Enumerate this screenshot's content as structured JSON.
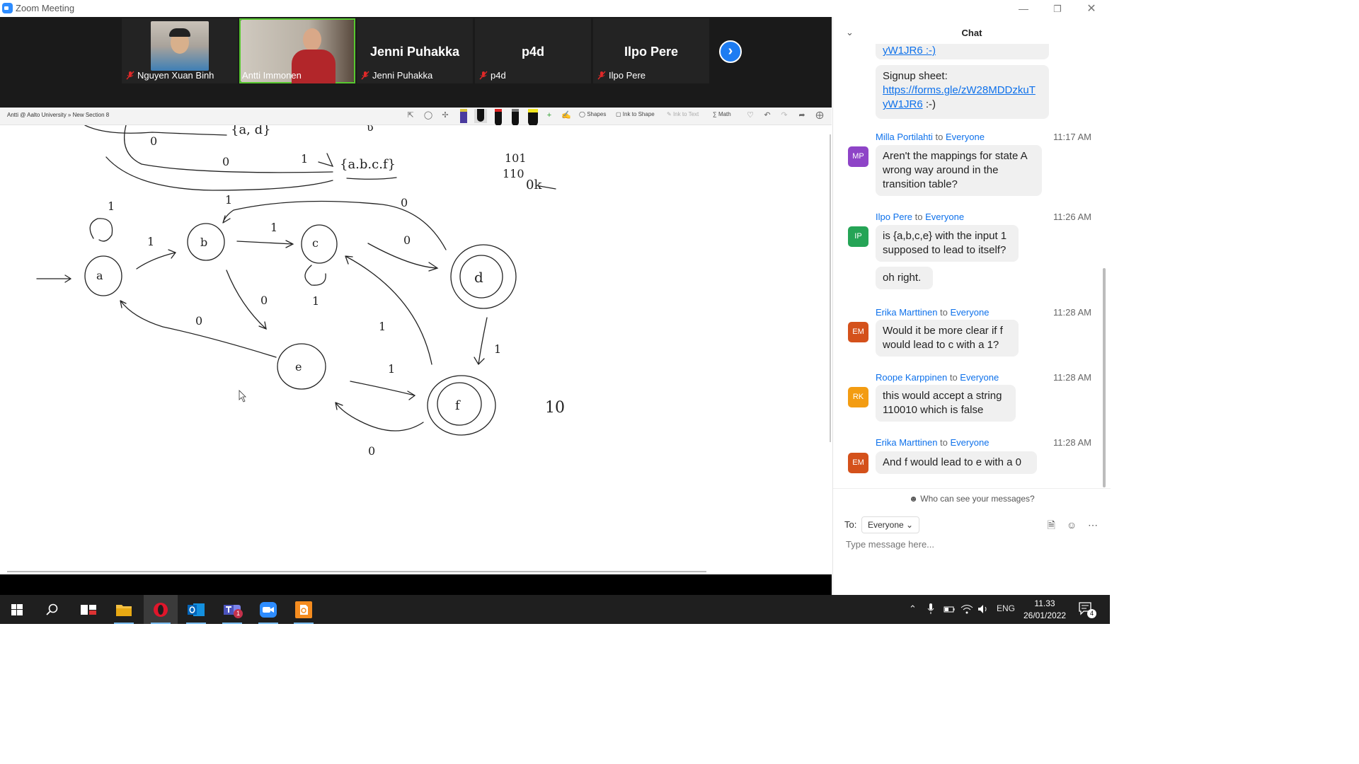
{
  "window": {
    "title": "Zoom Meeting",
    "minimize_icon": "minimize-icon",
    "restore_icon": "restore-icon",
    "close_icon": "close-icon"
  },
  "participants": [
    {
      "name": "Nguyen Xuan Binh",
      "muted": true,
      "video": true,
      "big_name": ""
    },
    {
      "name": "Antti Immonen",
      "muted": false,
      "video": true,
      "big_name": "",
      "speaking": true
    },
    {
      "name": "Jenni Puhakka",
      "muted": true,
      "video": false,
      "big_name": "Jenni Puhakka"
    },
    {
      "name": "p4d",
      "muted": true,
      "video": false,
      "big_name": "p4d"
    },
    {
      "name": "Ilpo Pere",
      "muted": true,
      "video": false,
      "big_name": "Ilpo Pere"
    }
  ],
  "whiteboard": {
    "notebook_title": "Antti @ Aalto University » New Section 8",
    "tools": {
      "shapes": "Shapes",
      "ink_to_shape": "Ink to Shape",
      "ink_to_text": "Ink to Text",
      "math": "Math"
    },
    "drawing": {
      "states": [
        "a",
        "b",
        "c",
        "d",
        "e",
        "f"
      ],
      "accepting_states": [
        "d",
        "f"
      ],
      "set_labels": [
        "{a, d}",
        "{a.b.c.f}"
      ],
      "notes": [
        "101",
        "110",
        "0k",
        "10"
      ]
    }
  },
  "chat": {
    "header": "Chat",
    "messages": [
      {
        "continued": true,
        "lines": [
          "yW1JR6 :-)"
        ]
      },
      {
        "continued": true,
        "text": "Signup sheet:",
        "link": "https://forms.gle/zW28MDDzkuTyW1JR6",
        "link_line1": "https://forms.gle/zW28MDDzkuT",
        "link_line2": "yW1JR6",
        "suffix": " :-)"
      },
      {
        "sender": "Milla Portilahti",
        "to_word": "to",
        "recipient": "Everyone",
        "time": "11:17 AM",
        "initials": "MP",
        "avatar_color": "#8e44c7",
        "lines": [
          "Aren't the mappings for state A",
          "wrong way around in the",
          "transition table?"
        ]
      },
      {
        "sender": "Ilpo Pere",
        "to_word": "to",
        "recipient": "Everyone",
        "time": "11:26 AM",
        "initials": "IP",
        "avatar_color": "#25a456",
        "lines": [
          "is {a,b,c,e} with the input 1",
          "supposed to lead to itself?"
        ],
        "followup": "oh right."
      },
      {
        "sender": "Erika Marttinen",
        "to_word": "to",
        "recipient": "Everyone",
        "time": "11:28 AM",
        "initials": "EM",
        "avatar_color": "#d4511b",
        "lines": [
          "Would it be more clear if f",
          "would lead to c with a 1?"
        ]
      },
      {
        "sender": "Roope Karppinen",
        "to_word": "to",
        "recipient": "Everyone",
        "time": "11:28 AM",
        "initials": "RK",
        "avatar_color": "#f39c12",
        "lines": [
          "this would accept a string",
          "110010 which is false"
        ]
      },
      {
        "sender": "Erika Marttinen",
        "to_word": "to",
        "recipient": "Everyone",
        "time": "11:28 AM",
        "initials": "EM",
        "avatar_color": "#d4511b",
        "lines": [
          "And f would lead to e with a 0"
        ]
      }
    ],
    "who_can_see": "Who can see your messages?",
    "to_label": "To:",
    "recipient_select": "Everyone",
    "input_placeholder": "Type message here..."
  },
  "taskbar": {
    "apps": [
      "windows-start",
      "search",
      "task-view",
      "file-explorer",
      "opera",
      "outlook",
      "teams",
      "zoom",
      "pdf-editor"
    ],
    "teams_badge": "1",
    "language": "ENG",
    "time": "11.33",
    "date": "26/01/2022",
    "notification_count": "4"
  }
}
